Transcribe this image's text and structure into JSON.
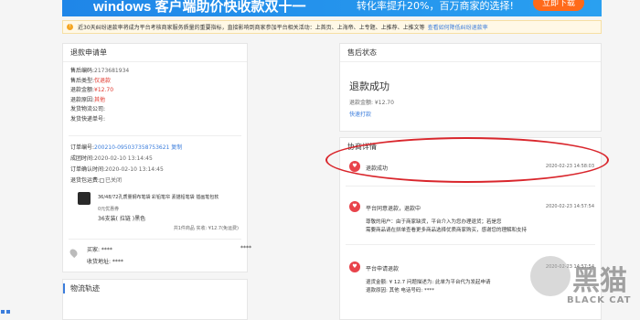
{
  "banner": {
    "title": "windows 客户端助价快收款双十一",
    "subtitle": "转化率提升20%，百万商家的选择!",
    "button": "立即下载"
  },
  "notice": {
    "icon": "info-icon",
    "text": "近30天纠纷退款率将成为平台考核商家服务质量的重要指标，直接影响到商家参加平台相关活动：上首页、上海帝、上专题、上推荐、上推文等",
    "link": "查看如何降低纠纷退款率"
  },
  "refund_request": {
    "title": "退款申请单",
    "fields": [
      {
        "label": "售后编码:",
        "value": "2173681934"
      },
      {
        "label": "售后类型:",
        "value": "仅退款"
      },
      {
        "label": "退款金额:",
        "value": "¥12.70"
      },
      {
        "label": "退款原因:",
        "value": "其他"
      },
      {
        "label": "发货物流公司:",
        "value": ""
      },
      {
        "label": "发货快递单号:",
        "value": ""
      }
    ],
    "order": [
      {
        "label": "订单编号:",
        "value": "200210-095037358753621",
        "link": "复制"
      },
      {
        "label": "成团时间:",
        "value": "2020-02-10 13:14:45"
      },
      {
        "label": "订单确认时间:",
        "value": "2020-02-10 13:14:45"
      },
      {
        "label": "退货包运费:",
        "value": "已关闭"
      }
    ],
    "product": {
      "name_line1": "36/48/72孔质量钢布笔袋 彩铅笔帘 素描铅笔袋 插画笔包软",
      "name_line2": "0元优惠券",
      "spec": "36支装( 拉链 )黑色",
      "total": "共1件商品  实收: ¥12.7(免运费)"
    },
    "buyer": {
      "label": "买家: ****",
      "stars": "****",
      "address": "收货地址: ****"
    }
  },
  "logistics": {
    "title": "物流轨迹"
  },
  "after_sale": {
    "title": "售后状态",
    "status": "退款成功",
    "amount": "退款金额:        ¥12.70",
    "link": "快速打款"
  },
  "negotiation": {
    "title": "协商详情",
    "items": [
      {
        "title": "退款成功",
        "time": "2020-02-23 14:58:03",
        "body": []
      },
      {
        "title": "平台同意退款，退款中",
        "time": "2020-02-23 14:57:54",
        "body": [
          "尊敬的用户：由于商家缺货，平台介入为您办理退货；若是您",
          "需要商品请在拼单查看更多商品选择优质商家购买，感谢您的理解和支持"
        ]
      },
      {
        "title": "平台申请退款",
        "time": "2020-02-23 14:57:54",
        "body": [
          "退货金额: ¥ 12.7  问题描述为: 此单为平台代为发起申请",
          "退款原因: 其他  电话号码: ****"
        ]
      }
    ]
  },
  "watermark": {
    "text": "黑猫",
    "sub": "BLACK CAT"
  }
}
